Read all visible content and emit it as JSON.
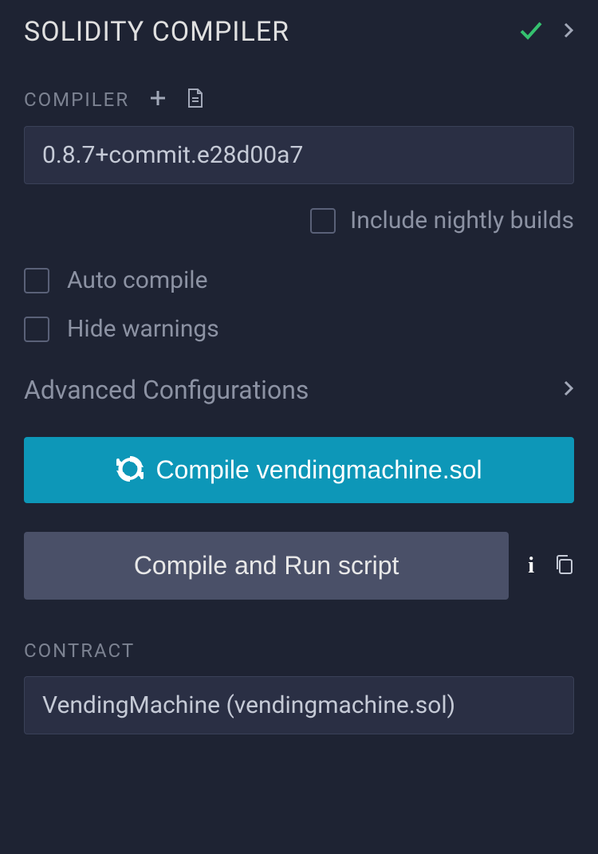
{
  "header": {
    "title": "SOLIDITY COMPILER"
  },
  "compiler": {
    "label": "COMPILER",
    "selected": "0.8.7+commit.e28d00a7"
  },
  "checkboxes": {
    "nightly": "Include nightly builds",
    "autoCompile": "Auto compile",
    "hideWarnings": "Hide warnings"
  },
  "advanced": {
    "label": "Advanced Configurations"
  },
  "compileButton": {
    "label": "Compile vendingmachine.sol"
  },
  "runScriptButton": {
    "label": "Compile and Run script"
  },
  "contract": {
    "label": "CONTRACT",
    "selected": "VendingMachine (vendingmachine.sol)"
  }
}
